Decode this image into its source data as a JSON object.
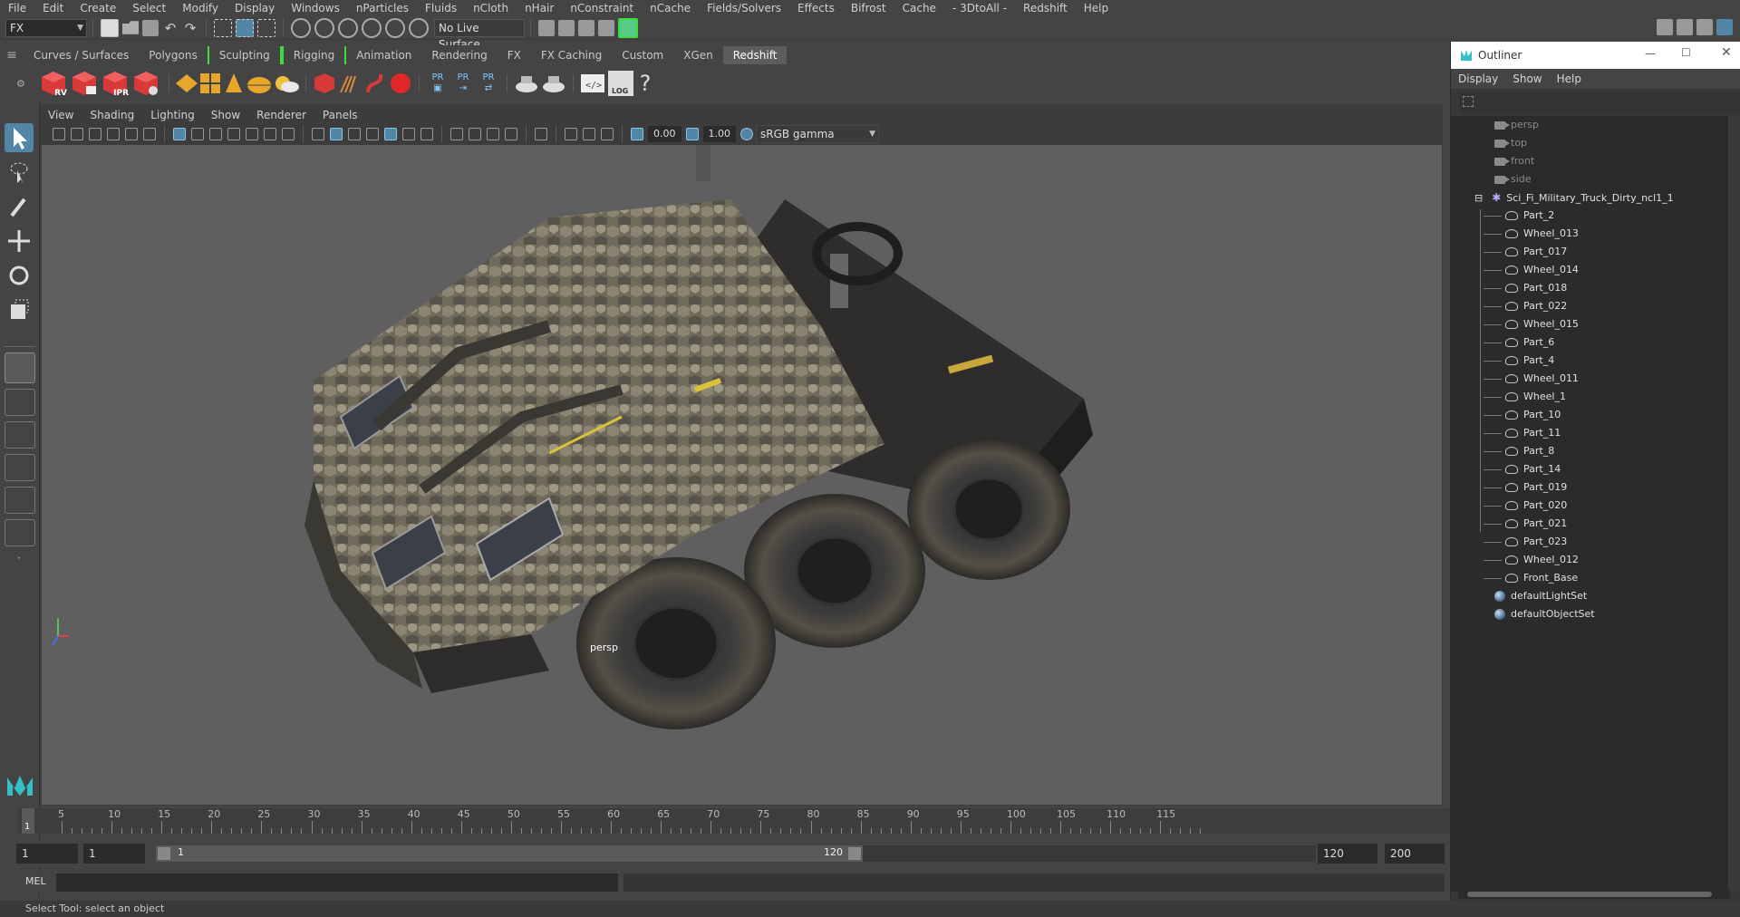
{
  "menubar": {
    "items": [
      "File",
      "Edit",
      "Create",
      "Select",
      "Modify",
      "Display",
      "Windows",
      "nParticles",
      "Fluids",
      "nCloth",
      "nHair",
      "nConstraint",
      "nCache",
      "Fields/Solvers",
      "Effects",
      "Bifrost",
      "Cache",
      "- 3DtoAll -",
      "Redshift",
      "Help"
    ]
  },
  "statusline": {
    "mode": "FX",
    "live_surface": "No Live Surface"
  },
  "shelf_tabs": [
    {
      "label": "Curves / Surfaces"
    },
    {
      "label": "Polygons"
    },
    {
      "label": "Sculpting"
    },
    {
      "label": "Rigging"
    },
    {
      "label": "Animation"
    },
    {
      "label": "Rendering"
    },
    {
      "label": "FX"
    },
    {
      "label": "FX Caching"
    },
    {
      "label": "Custom"
    },
    {
      "label": "XGen"
    },
    {
      "label": "Redshift"
    }
  ],
  "shelf": {
    "rs_labels": [
      "RV",
      "",
      "IPR",
      ""
    ],
    "pr_labels": [
      "PR",
      "PR",
      "PR"
    ],
    "log_label": "LOG",
    "help_glyph": "?"
  },
  "viewport": {
    "menu": [
      "View",
      "Shading",
      "Lighting",
      "Show",
      "Renderer",
      "Panels"
    ],
    "exposure": "0.00",
    "gamma": "1.00",
    "color_space": "sRGB gamma",
    "camera_label": "persp"
  },
  "timeline": {
    "ticks": [
      "5",
      "10",
      "15",
      "20",
      "25",
      "30",
      "35",
      "40",
      "45",
      "50",
      "55",
      "60",
      "65",
      "70",
      "75",
      "80",
      "85",
      "90",
      "95",
      "100",
      "105",
      "110",
      "115"
    ],
    "current_frame": "1"
  },
  "range": {
    "start": "1",
    "anim_start": "1",
    "slider_start": "1",
    "slider_end": "120",
    "end": "120",
    "anim_end": "200"
  },
  "cmdline": {
    "language": "MEL"
  },
  "helpline": {
    "text": "Select Tool: select an object"
  },
  "outliner": {
    "title": "Outliner",
    "menu": [
      "Display",
      "Show",
      "Help"
    ],
    "cameras": [
      "persp",
      "top",
      "front",
      "side"
    ],
    "group": "Sci_Fi_Military_Truck_Dirty_ncl1_1",
    "children": [
      "Part_2",
      "Wheel_013",
      "Part_017",
      "Wheel_014",
      "Part_018",
      "Part_022",
      "Wheel_015",
      "Part_6",
      "Part_4",
      "Wheel_011",
      "Wheel_1",
      "Part_10",
      "Part_11",
      "Part_8",
      "Part_14",
      "Part_019",
      "Part_020",
      "Part_021",
      "Part_023",
      "Wheel_012",
      "Front_Base"
    ],
    "sets": [
      "defaultLightSet",
      "defaultObjectSet"
    ]
  }
}
